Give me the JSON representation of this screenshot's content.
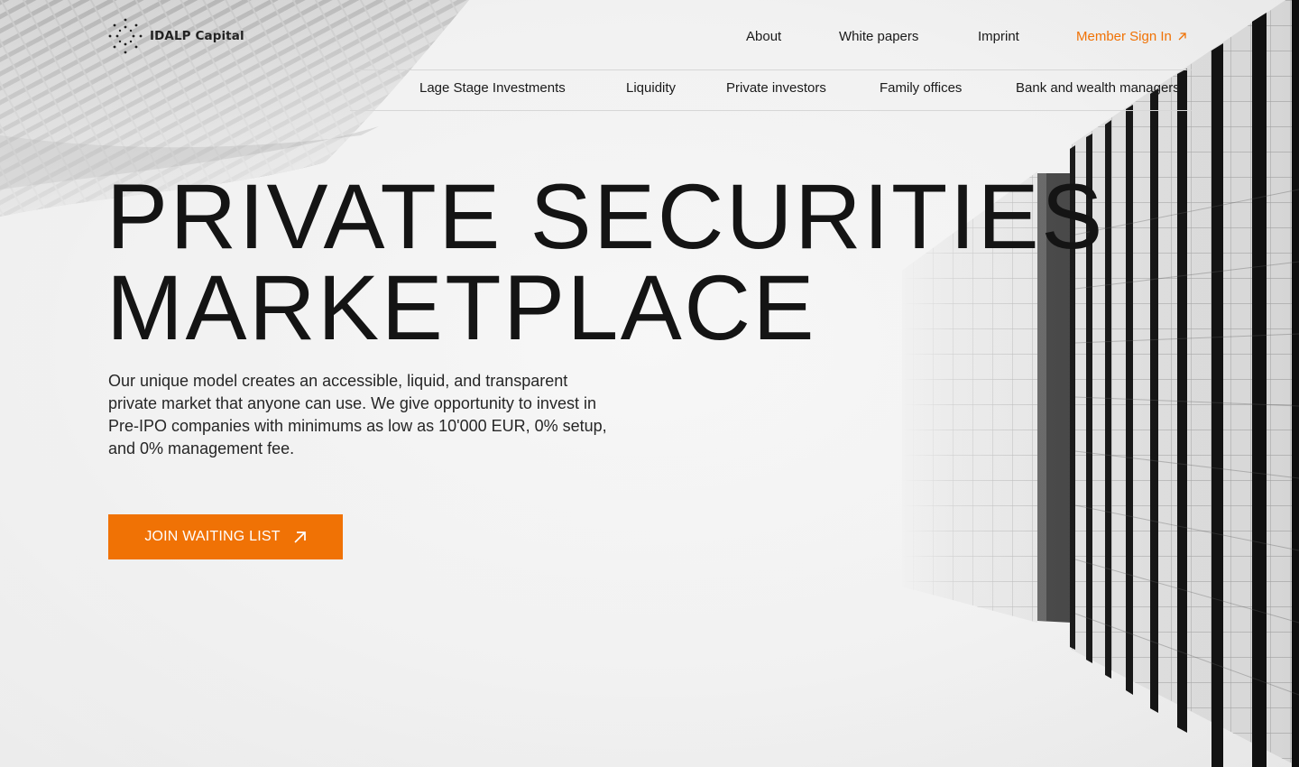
{
  "brand": {
    "name": "IDALP Capital",
    "accent_color": "#f07205",
    "text_color": "#1a1a1a"
  },
  "nav": {
    "top": [
      {
        "label": "About"
      },
      {
        "label": "White papers"
      },
      {
        "label": "Imprint"
      }
    ],
    "member_sign_in": {
      "label": "Member Sign In",
      "icon": "arrow-up-right-icon"
    },
    "sub": [
      {
        "label": "Lage Stage Investments"
      },
      {
        "label": "Liquidity"
      },
      {
        "label": "Private investors"
      },
      {
        "label": "Family offices"
      },
      {
        "label": "Bank and wealth managers"
      }
    ]
  },
  "hero": {
    "title_line1": "PRIVATE SECURITIES",
    "title_line2": "MARKETPLACE",
    "description": "Our unique model creates an accessible, liquid, and transparent private market that anyone can use. We give opportunity to invest in Pre-IPO companies with minimums as low as 10'000 EUR, 0% setup, and 0% management fee.",
    "cta_label": "JOIN WAITING LIST",
    "cta_icon": "arrow-up-right-icon"
  }
}
